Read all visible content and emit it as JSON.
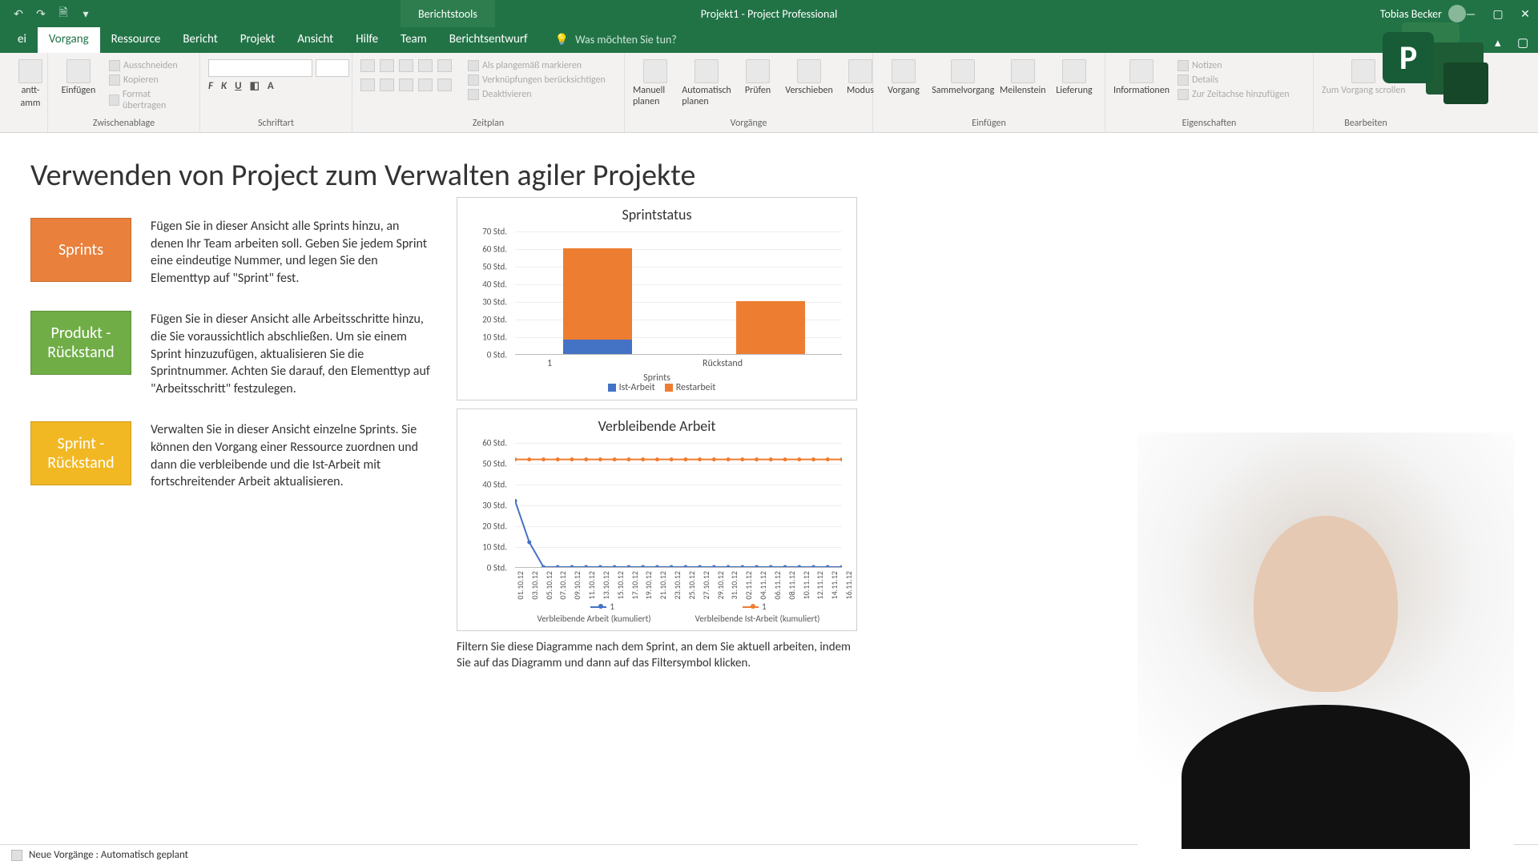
{
  "title_bar": {
    "contextual_tab": "Berichtstools",
    "doc_title": "Projekt1  -  Project Professional",
    "user": "Tobias Becker"
  },
  "tabs": {
    "file": "ei",
    "main": [
      "Vorgang",
      "Ressource",
      "Bericht",
      "Projekt",
      "Ansicht",
      "Hilfe",
      "Team",
      "Berichtsentwurf"
    ],
    "active": "Vorgang",
    "tellme": "Was möchten Sie tun?"
  },
  "ribbon": {
    "view": {
      "gantt_top": "antt-",
      "gantt_bot": "amm"
    },
    "clipboard": {
      "paste": "Einfügen",
      "cut": "Ausschneiden",
      "copy": "Kopieren",
      "format_painter": "Format übertragen",
      "label": "Zwischenablage"
    },
    "font": {
      "label": "Schriftart"
    },
    "schedule": {
      "mark_on_track": "Als plangemäß markieren",
      "respect_links": "Verknüpfungen berücksichtigen",
      "deactivate": "Deaktivieren",
      "label": "Zeitplan"
    },
    "tasks": {
      "manual": "Manuell planen",
      "auto": "Automatisch planen",
      "inspect": "Prüfen",
      "move": "Verschieben",
      "mode": "Modus",
      "label": "Vorgänge"
    },
    "insert": {
      "task": "Vorgang",
      "summary": "Sammelvorgang",
      "milestone": "Meilenstein",
      "deliverable": "Lieferung",
      "label": "Einfügen"
    },
    "properties": {
      "information": "Informationen",
      "notes": "Notizen",
      "details": "Details",
      "timeline": "Zur Zeitachse hinzufügen",
      "label": "Eigenschaften"
    },
    "editing": {
      "scroll": "Zum Vorgang scrollen",
      "label": "Bearbeiten"
    }
  },
  "report": {
    "title": "Verwenden von Project zum Verwalten agiler Projekte",
    "blocks": [
      {
        "tile": "Sprints",
        "color": "orange",
        "text": "Fügen Sie in dieser Ansicht alle Sprints hinzu, an denen Ihr Team arbeiten soll. Geben Sie jedem Sprint eine eindeutige Nummer, und legen Sie den Elementtyp auf \"Sprint\" fest."
      },
      {
        "tile": "Produkt - Rückstand",
        "color": "green",
        "text": "Fügen Sie in dieser Ansicht alle Arbeitsschritte hinzu, die Sie voraussichtlich abschließen. Um sie einem Sprint hinzuzufügen, aktualisieren Sie die Sprintnummer. Achten Sie darauf, den Elementtyp auf \"Arbeitsschritt\" festzulegen."
      },
      {
        "tile": "Sprint - Rückstand",
        "color": "amber",
        "text": "Verwalten Sie in dieser Ansicht einzelne Sprints. Sie können den Vorgang einer Ressource zuordnen und dann die verbleibende und die Ist-Arbeit mit fortschreitender Arbeit aktualisieren."
      }
    ],
    "filter_hint": "Filtern Sie diese Diagramme nach dem Sprint, an dem Sie aktuell arbeiten, indem Sie auf das Diagramm und dann auf das Filtersymbol klicken."
  },
  "chart_data": [
    {
      "type": "bar",
      "title": "Sprintstatus",
      "xlabel": "Sprints",
      "ylabel": "",
      "ylim": [
        0,
        70
      ],
      "ytick_suffix": " Std.",
      "categories": [
        "1",
        "Rückstand"
      ],
      "series": [
        {
          "name": "Ist-Arbeit",
          "color": "#4472c4",
          "values": [
            8,
            0
          ]
        },
        {
          "name": "Restarbeit",
          "color": "#ed7d31",
          "values": [
            52,
            30
          ]
        }
      ]
    },
    {
      "type": "line",
      "title": "Verbleibende Arbeit",
      "ylabel": "",
      "ylim": [
        0,
        60
      ],
      "ytick_suffix": " Std.",
      "x": [
        "01.10.12",
        "03.10.12",
        "05.10.12",
        "07.10.12",
        "09.10.12",
        "11.10.12",
        "13.10.12",
        "15.10.12",
        "17.10.12",
        "19.10.12",
        "21.10.12",
        "23.10.12",
        "25.10.12",
        "27.10.12",
        "29.10.12",
        "31.10.12",
        "02.11.12",
        "04.11.12",
        "06.11.12",
        "08.11.12",
        "10.11.12",
        "12.11.12",
        "14.11.12",
        "16.11.12"
      ],
      "series": [
        {
          "name": "1",
          "legend_label": "Verbleibende Arbeit (kumuliert)",
          "color": "#4472c4",
          "values": [
            32,
            12,
            0,
            0,
            0,
            0,
            0,
            0,
            0,
            0,
            0,
            0,
            0,
            0,
            0,
            0,
            0,
            0,
            0,
            0,
            0,
            0,
            0,
            0
          ]
        },
        {
          "name": "1",
          "legend_label": "Verbleibende Ist-Arbeit (kumuliert)",
          "color": "#ed7d31",
          "values": [
            52,
            52,
            52,
            52,
            52,
            52,
            52,
            52,
            52,
            52,
            52,
            52,
            52,
            52,
            52,
            52,
            52,
            52,
            52,
            52,
            52,
            52,
            52,
            52
          ]
        }
      ]
    }
  ],
  "status_bar": {
    "text": "Neue Vorgänge : Automatisch geplant"
  }
}
